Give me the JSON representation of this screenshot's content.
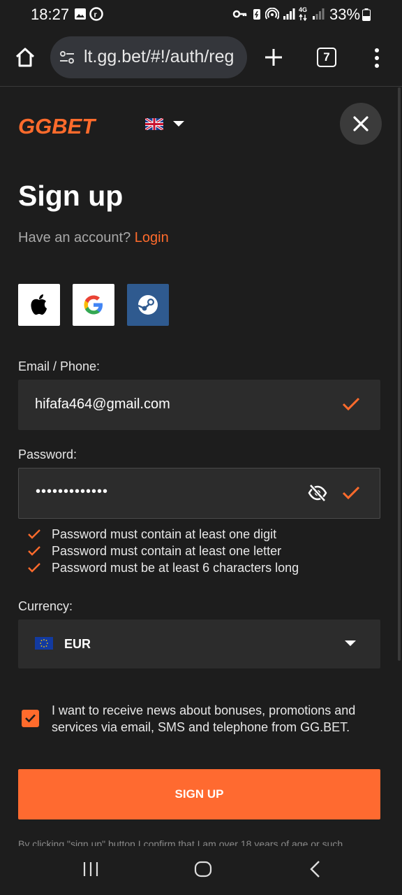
{
  "status_bar": {
    "time": "18:27",
    "battery": "33%",
    "network": "4G"
  },
  "browser": {
    "url": "lt.gg.bet/#!/auth/reg",
    "tab_count": "7"
  },
  "header": {
    "logo_left": "GG",
    "logo_right": "BET",
    "language_flag": "uk-flag-icon"
  },
  "form": {
    "title": "Sign up",
    "have_account": "Have an account?",
    "login_link": "Login",
    "social": [
      "apple-icon",
      "google-icon",
      "steam-icon"
    ],
    "email_label": "Email / Phone:",
    "email_value": "hifafa464@gmail.com",
    "password_label": "Password:",
    "password_value": "•••••••••••••",
    "password_rules": [
      "Password must contain at least one digit",
      "Password must contain at least one letter",
      "Password must be at least 6 characters long"
    ],
    "currency_label": "Currency:",
    "currency_value": "EUR",
    "consent_text": "I want to receive news about bonuses, promotions and services via email, SMS and telephone from GG.BET.",
    "consent_checked": true,
    "signup_button": "SIGN UP",
    "disclaimer": "By clicking \"sign up\" button I confirm that I am over 18 years of age or such"
  },
  "colors": {
    "accent": "#ff6b2c",
    "background": "#1d1d1d",
    "field": "#2c2c2c"
  }
}
